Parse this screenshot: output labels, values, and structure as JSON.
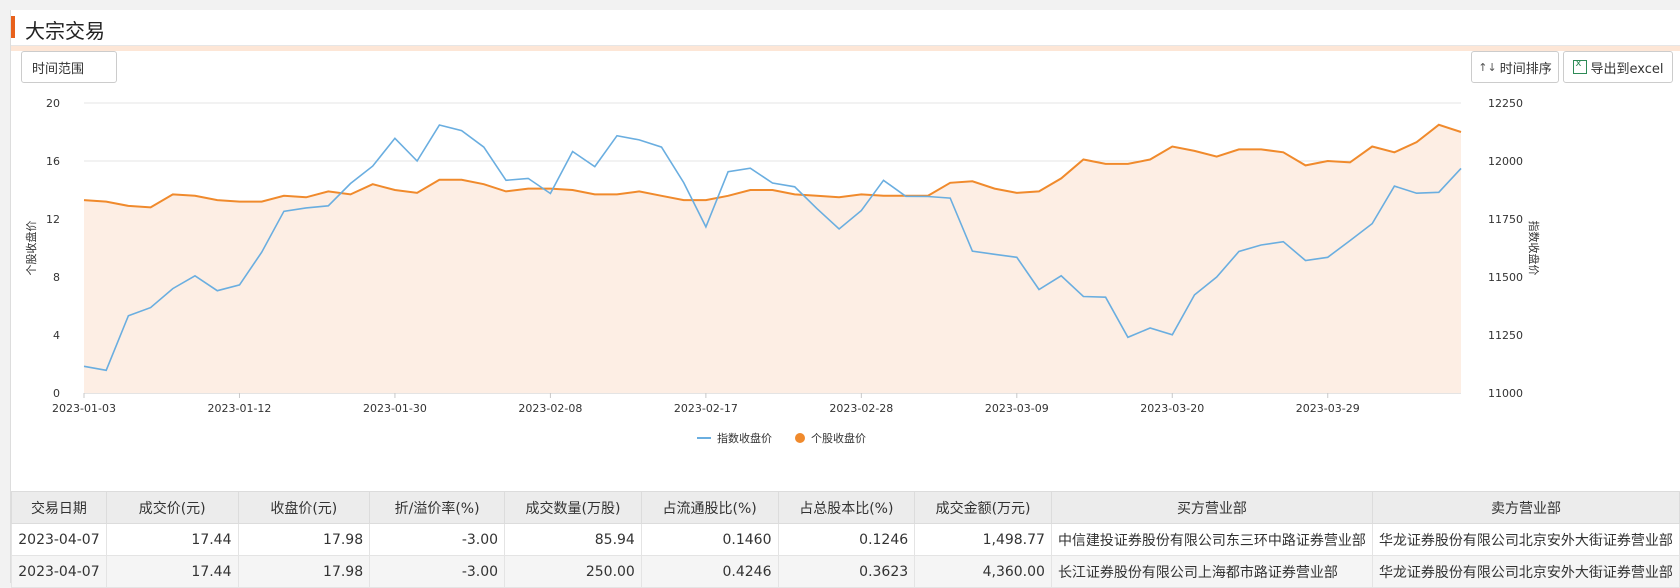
{
  "header": {
    "title": "大宗交易"
  },
  "toolbar": {
    "range_label": "时间范围",
    "sort_label": "时间排序",
    "sort_icon": "sort-arrows-icon",
    "excel_label": "导出到excel",
    "excel_icon": "excel-icon"
  },
  "colors": {
    "accent": "#e8611c",
    "index_line": "#6aaee0",
    "stock_line": "#f08a2c",
    "area_fill": "#fdeee4"
  },
  "chart_data": {
    "type": "line",
    "ylabel_left": "个股收盘价",
    "ylabel_right": "指数收盘价",
    "ylim_left": [
      0,
      20
    ],
    "ylim_right": [
      11000,
      12250
    ],
    "yticks_left": [
      "20",
      "16",
      "12",
      "8",
      "4",
      "0"
    ],
    "yticks_right": [
      "12250",
      "12000",
      "11750",
      "11500",
      "11250",
      "11000"
    ],
    "xtick_labels": [
      "2023-01-03",
      "2023-01-12",
      "2023-01-30",
      "2023-02-08",
      "2023-02-17",
      "2023-02-28",
      "2023-03-09",
      "2023-03-20",
      "2023-03-29"
    ],
    "legend": {
      "position": "bottom",
      "items": [
        "指数收盘价",
        "个股收盘价"
      ]
    },
    "grid": true,
    "series": [
      {
        "name": "指数收盘价",
        "axis": "right",
        "style": "line",
        "values": [
          11115,
          11098,
          11333,
          11368,
          11450,
          11505,
          11441,
          11466,
          11607,
          11783,
          11798,
          11807,
          11903,
          11978,
          12098,
          12000,
          12155,
          12131,
          12060,
          11917,
          11925,
          11860,
          12041,
          11976,
          12109,
          12091,
          12060,
          11907,
          11716,
          11954,
          11969,
          11905,
          11889,
          11795,
          11707,
          11786,
          11917,
          11848,
          11847,
          11840,
          11611,
          11598,
          11585,
          11446,
          11505,
          11416,
          11413,
          11240,
          11280,
          11251,
          11423,
          11500,
          11610,
          11638,
          11652,
          11571,
          11585,
          11657,
          11730,
          11892,
          11861,
          11865,
          11968
        ]
      },
      {
        "name": "个股收盘价",
        "axis": "left",
        "style": "area",
        "values": [
          13.3,
          13.2,
          12.9,
          12.8,
          13.7,
          13.6,
          13.3,
          13.2,
          13.2,
          13.6,
          13.5,
          13.9,
          13.7,
          14.4,
          14.0,
          13.8,
          14.7,
          14.7,
          14.4,
          13.9,
          14.1,
          14.1,
          14.0,
          13.7,
          13.7,
          13.9,
          13.6,
          13.3,
          13.3,
          13.6,
          14.0,
          14.0,
          13.7,
          13.6,
          13.5,
          13.7,
          13.6,
          13.6,
          13.6,
          14.5,
          14.6,
          14.1,
          13.8,
          13.9,
          14.8,
          16.1,
          15.8,
          15.8,
          16.1,
          17.0,
          16.7,
          16.3,
          16.8,
          16.8,
          16.6,
          15.7,
          16.0,
          15.9,
          17.0,
          16.6,
          17.3,
          18.5,
          18.0
        ]
      }
    ]
  },
  "table": {
    "columns": [
      "交易日期",
      "成交价(元)",
      "收盘价(元)",
      "折/溢价率(%)",
      "成交数量(万股)",
      "占流通股比(%)",
      "占总股本比(%)",
      "成交金额(万元)",
      "买方营业部",
      "卖方营业部"
    ],
    "rows": [
      [
        "2023-04-07",
        "17.44",
        "17.98",
        "-3.00",
        "85.94",
        "0.1460",
        "0.1246",
        "1,498.77",
        "中信建投证券股份有限公司东三环中路证券营业部",
        "华龙证券股份有限公司北京安外大街证券营业部"
      ],
      [
        "2023-04-07",
        "17.44",
        "17.98",
        "-3.00",
        "250.00",
        "0.4246",
        "0.3623",
        "4,360.00",
        "长江证券股份有限公司上海都市路证券营业部",
        "华龙证券股份有限公司北京安外大街证券营业部"
      ]
    ]
  }
}
